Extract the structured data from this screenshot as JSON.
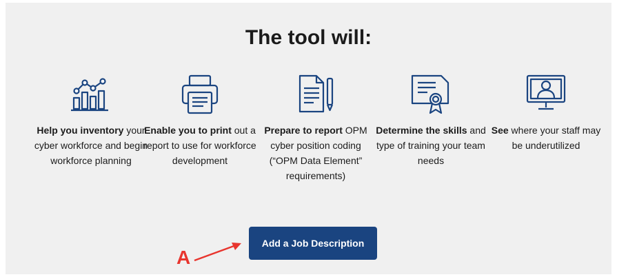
{
  "section": {
    "title": "The tool will:"
  },
  "features": [
    {
      "bold": "Help you inventory",
      "rest": " your cyber workforce and begin workforce planning",
      "icon": "chart-icon"
    },
    {
      "bold": "Enable you to print",
      "rest": " out a report to use for workforce development",
      "icon": "printer-icon"
    },
    {
      "bold": "Prepare to report",
      "rest": " OPM cyber position coding (“OPM Data Element” requirements)",
      "icon": "document-pen-icon"
    },
    {
      "bold": "Determine the skills",
      "rest": " and type of training your team needs",
      "icon": "certificate-icon"
    },
    {
      "bold": "See",
      "rest": " where your staff may be underutilized",
      "icon": "staff-monitor-icon"
    }
  ],
  "cta": {
    "label": "Add a Job Description"
  },
  "annotation": {
    "label": "A",
    "color": "#e8352e"
  },
  "colors": {
    "icon": "#1a4480",
    "button_bg": "#1a4480",
    "panel_bg": "#f0f0f0"
  }
}
